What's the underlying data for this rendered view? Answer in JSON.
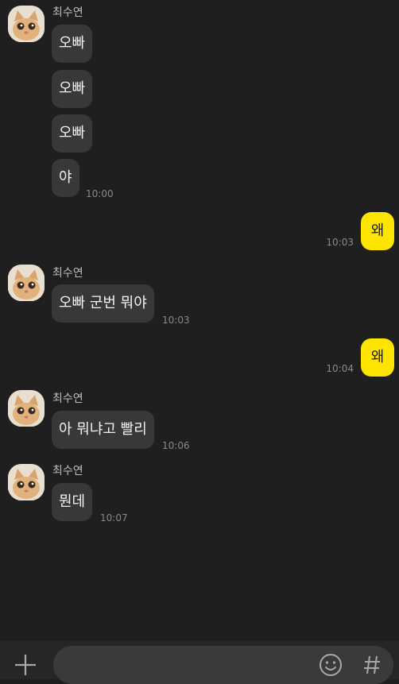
{
  "colors": {
    "background": "#1f1f1f",
    "received_bubble": "#383838",
    "sent_bubble": "#fee500"
  },
  "contact": {
    "name": "최수연",
    "avatar_icon": "cat-avatar-icon"
  },
  "messages": [
    {
      "from": "them",
      "text": "오빠"
    },
    {
      "from": "them",
      "text": "오빠"
    },
    {
      "from": "them",
      "text": "오빠"
    },
    {
      "from": "them",
      "text": "야",
      "time": "10:00"
    },
    {
      "from": "me",
      "text": "왜",
      "time": "10:03"
    },
    {
      "from": "them",
      "text": "오빠 군번 뭐야",
      "time": "10:03"
    },
    {
      "from": "me",
      "text": "왜",
      "time": "10:04"
    },
    {
      "from": "them",
      "text": "아 뭐냐고 빨리",
      "time": "10:06"
    },
    {
      "from": "them",
      "text": "뭔데",
      "time": "10:07"
    }
  ],
  "input_bar": {
    "placeholder": "",
    "icons": [
      "plus-icon",
      "emoji-icon",
      "hashtag-icon"
    ]
  }
}
